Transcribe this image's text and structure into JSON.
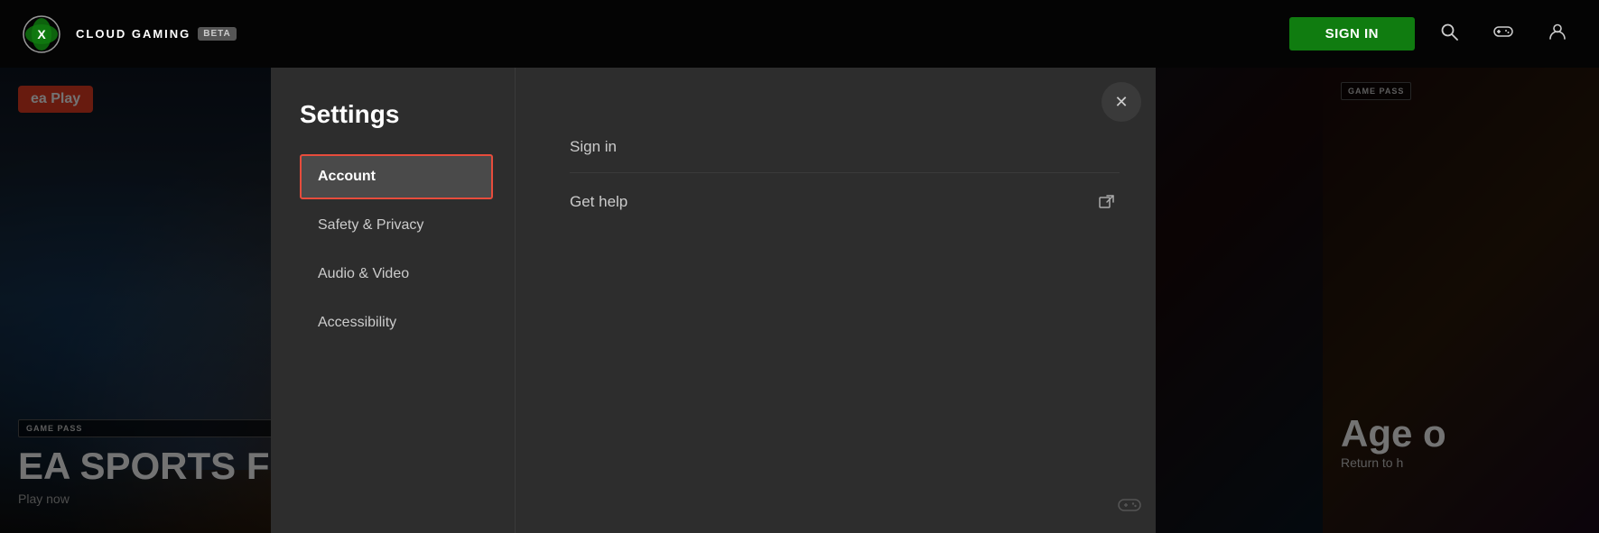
{
  "navbar": {
    "logo_alt": "Xbox",
    "cloud_gaming_label": "CLOUD GAMING",
    "beta_badge": "BETA",
    "sign_in_label": "SIGN IN",
    "search_icon": "🔍",
    "controller_icon": "🎮",
    "account_icon": "👤"
  },
  "settings": {
    "title": "Settings",
    "close_icon": "✕",
    "menu_items": [
      {
        "id": "account",
        "label": "Account",
        "active": true
      },
      {
        "id": "safety-privacy",
        "label": "Safety & Privacy",
        "active": false
      },
      {
        "id": "audio-video",
        "label": "Audio & Video",
        "active": false
      },
      {
        "id": "accessibility",
        "label": "Accessibility",
        "active": false
      }
    ],
    "content_items": [
      {
        "id": "sign-in",
        "label": "Sign in",
        "has_external": false
      },
      {
        "id": "get-help",
        "label": "Get help",
        "has_external": true
      }
    ],
    "external_link_icon": "⧉",
    "controller_icon": "🎮"
  },
  "hero": {
    "ea_play_badge": "ea Play",
    "ea_play_icon": "EA",
    "game_title": "EA SPORTS FC",
    "game_subtitle": "Play now",
    "game_pass_badge": "GAME\nPASS",
    "right_age_label": "Age o",
    "right_return_label": "Return to h"
  }
}
